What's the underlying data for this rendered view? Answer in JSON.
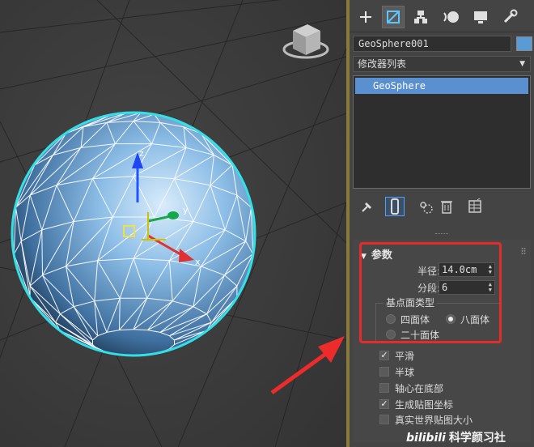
{
  "viewport": {
    "gizmo_labels": {
      "x": "x",
      "y": "y",
      "z": "z"
    },
    "colors": {
      "wire_select": "#33e0e8",
      "sphere": "#7fb2e0",
      "arrow": "#e83a2f"
    }
  },
  "panel": {
    "tabs": [
      "create-tab",
      "modify-tab",
      "hierarchy-tab",
      "motion-tab",
      "display-tab",
      "utilities-tab"
    ],
    "active_tab": "modify-tab",
    "object_name": "GeoSphere001",
    "object_color": "#5b9bd5",
    "modifier_list": "修改器列表",
    "stack_items": [
      "GeoSphere"
    ],
    "params": {
      "title": "参数",
      "radius_label": "半径:",
      "radius_value": "14.0cm",
      "segments_label": "分段:",
      "segments_value": "6",
      "base_type_title": "基点面类型",
      "base_types": [
        "四面体",
        "八面体",
        "二十面体"
      ],
      "selected_base_type": "八面体",
      "options": [
        {
          "label": "平滑",
          "checked": true
        },
        {
          "label": "半球",
          "checked": false
        },
        {
          "label": "轴心在底部",
          "checked": false
        },
        {
          "label": "生成贴图坐标",
          "checked": true
        },
        {
          "label": "真实世界贴图大小",
          "checked": false
        }
      ]
    }
  },
  "watermark": {
    "logo": "bilibili",
    "text": "科学颜习社"
  }
}
